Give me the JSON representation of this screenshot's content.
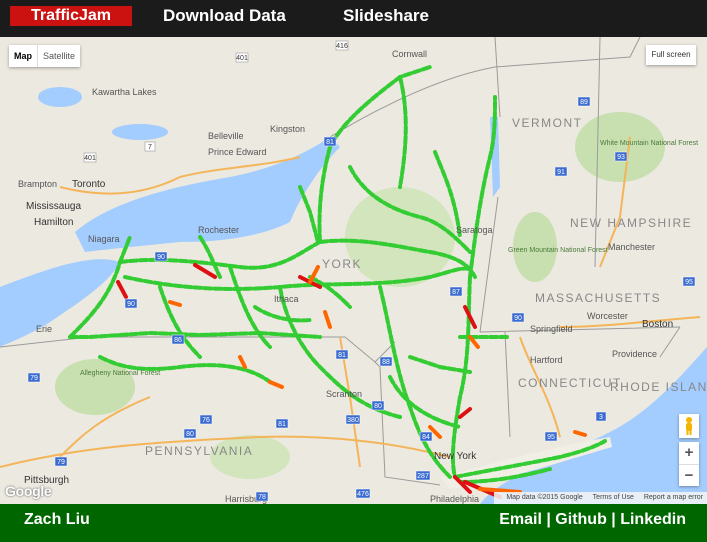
{
  "nav": {
    "brand": "TrafficJam",
    "links": [
      "Download Data",
      "Slideshare"
    ]
  },
  "map_controls": {
    "map_button": "Map",
    "satellite_button": "Satellite",
    "fullscreen_button": "Full screen",
    "google_logo": "Google",
    "attribution": "Map data ©2015 Google",
    "terms": "Terms of Use",
    "report": "Report a map error",
    "zoom_in": "+",
    "zoom_out": "−"
  },
  "map": {
    "water_color": "#a3ccff",
    "land_color": "#ece9e0",
    "park_color": "#c8dfb0",
    "traffic_colors": {
      "free": "#33cc33",
      "moderate": "#ff6600",
      "heavy": "#dd1111"
    },
    "places": [
      {
        "name": "Kawartha Lakes",
        "kind": "town"
      },
      {
        "name": "Belleville",
        "kind": "town"
      },
      {
        "name": "Kingston",
        "kind": "town"
      },
      {
        "name": "Prince Edward",
        "kind": "town"
      },
      {
        "name": "Brampton",
        "kind": "town"
      },
      {
        "name": "Toronto",
        "kind": "city"
      },
      {
        "name": "Mississauga",
        "kind": "city"
      },
      {
        "name": "Hamilton",
        "kind": "city"
      },
      {
        "name": "Niagara",
        "kind": "town"
      },
      {
        "name": "Cornwall",
        "kind": "town"
      },
      {
        "name": "VERMONT",
        "kind": "region"
      },
      {
        "name": "White Mountain National Forest",
        "kind": "park"
      },
      {
        "name": "NEW HAMPSHIRE",
        "kind": "region"
      },
      {
        "name": "Green Mountain National Forest",
        "kind": "park"
      },
      {
        "name": "Manchester",
        "kind": "town"
      },
      {
        "name": "MASSACHUSETTS",
        "kind": "region"
      },
      {
        "name": "Worcester",
        "kind": "town"
      },
      {
        "name": "Boston",
        "kind": "city"
      },
      {
        "name": "Springfield",
        "kind": "town"
      },
      {
        "name": "Providence",
        "kind": "town"
      },
      {
        "name": "Hartford",
        "kind": "town"
      },
      {
        "name": "CONNECTICUT",
        "kind": "region"
      },
      {
        "name": "RHODE ISLAND",
        "kind": "region"
      },
      {
        "name": "Erie",
        "kind": "town"
      },
      {
        "name": "Allegheny National Forest",
        "kind": "park"
      },
      {
        "name": "PENNSYLVANIA",
        "kind": "region"
      },
      {
        "name": "Scranton",
        "kind": "town"
      },
      {
        "name": "Pittsburgh",
        "kind": "city"
      },
      {
        "name": "New York",
        "kind": "city"
      },
      {
        "name": "YORK",
        "kind": "region"
      },
      {
        "name": "Rochester",
        "kind": "town"
      },
      {
        "name": "Ithaca",
        "kind": "town"
      },
      {
        "name": "Saratoga",
        "kind": "town"
      },
      {
        "name": "Harrisburg",
        "kind": "town"
      },
      {
        "name": "Philadelphia",
        "kind": "town"
      }
    ],
    "shields": [
      "416",
      "401",
      "7",
      "401",
      "89",
      "90",
      "81",
      "91",
      "93",
      "95",
      "87",
      "90",
      "90",
      "86",
      "81",
      "88",
      "380",
      "80",
      "76",
      "79",
      "81",
      "287",
      "84",
      "476",
      "78",
      "95",
      "3",
      "79",
      "80"
    ]
  },
  "footer": {
    "author": "Zach Liu",
    "links": "Email | Github | Linkedin"
  }
}
